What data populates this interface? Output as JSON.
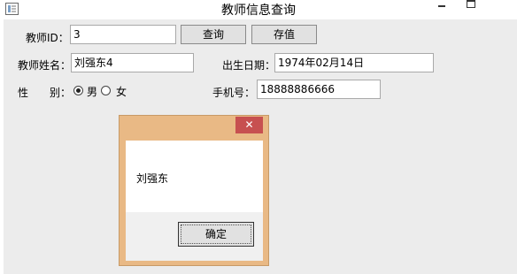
{
  "window": {
    "title": "教师信息查询",
    "close_glyph": "✕"
  },
  "form": {
    "teacher_id_label": "教师ID：",
    "teacher_id_value": "3",
    "query_button": "查询",
    "save_button": "存值",
    "name_label": "教师姓名：",
    "name_value": "刘强东4",
    "birth_label": "出生日期：",
    "birth_value": "1974年02月14日",
    "gender_label": "性　　别：",
    "gender_options": [
      {
        "label": "男",
        "checked": true
      },
      {
        "label": "女",
        "checked": false
      }
    ],
    "phone_label": "手机号：",
    "phone_value": "18888886666"
  },
  "dialog": {
    "message": "刘强东",
    "ok_button": "确定",
    "close_glyph": "✕"
  },
  "colors": {
    "dialog_frame": "#e9b985",
    "dialog_close": "#c75050",
    "client_bg": "#ececec"
  }
}
